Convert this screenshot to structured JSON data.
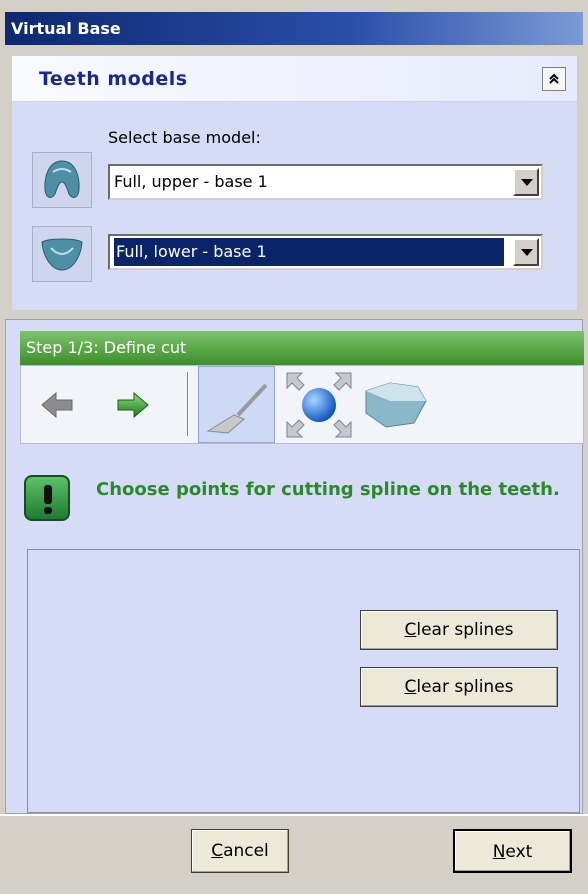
{
  "window": {
    "title": "Virtual Base"
  },
  "models": {
    "title": "Teeth models",
    "collapse_label": "»",
    "select_label": "Select base model:",
    "upper_value": "Full, upper - base 1",
    "lower_value": "Full, lower - base 1"
  },
  "step": {
    "header": "Step 1/3: Define cut",
    "message": "Choose points for cutting spline on the teeth."
  },
  "buttons": {
    "clear1_prefix": "C",
    "clear1_rest": "lear splines",
    "clear2_prefix": "C",
    "clear2_rest": "lear splines",
    "cancel_prefix": "C",
    "cancel_rest": "ancel",
    "next_prefix": "N",
    "next_rest": "ext"
  },
  "icons": {
    "collapse": "chevron-up-double-icon",
    "back": "arrow-left-icon",
    "forward": "arrow-right-icon",
    "cut_tool": "trowel-icon",
    "transform_tool": "sphere-expand-icon",
    "base_tool": "base-shape-icon",
    "message": "exclamation-icon"
  },
  "colors": {
    "title_gradient_start": "#0c2870",
    "step_header": "#4ea23c",
    "message_text": "#2a8a2a",
    "selected_bg": "#0a246a"
  }
}
